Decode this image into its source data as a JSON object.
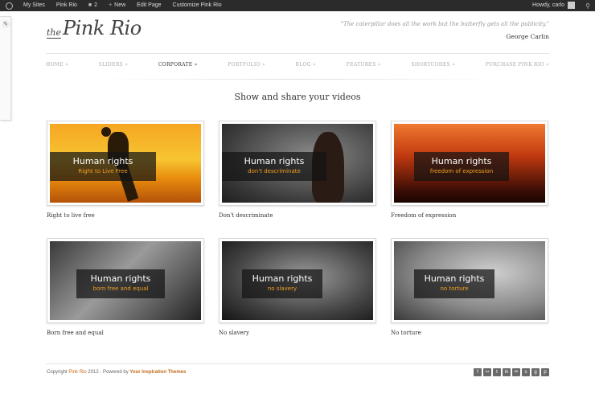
{
  "adminbar": {
    "my_sites": "My Sites",
    "site_name": "Pink Rio",
    "comments_count": "2",
    "new_label": "New",
    "edit_page": "Edit Page",
    "customize": "Customize Pink Rio",
    "howdy": "Howdy, carlo"
  },
  "header": {
    "logo_the": "the",
    "logo_name": "Pink Rio",
    "quote_text": "\"The caterpillar does all the work but the butterfly gets all the publicity.\"",
    "quote_author": "George Carlin"
  },
  "nav": {
    "items": [
      {
        "label": "HOME »"
      },
      {
        "label": "SLIDERS »"
      },
      {
        "label": "CORPORATE »"
      },
      {
        "label": "PORTFOLIO »"
      },
      {
        "label": "BLOG »"
      },
      {
        "label": "FEATURES »"
      },
      {
        "label": "SHORTCODES »"
      },
      {
        "label": "PURCHASE PINK RIO »"
      }
    ],
    "active_index": 2
  },
  "section_title": "Show and share your videos",
  "videos": [
    {
      "heading": "Human rights",
      "subtitle": "Right to Live Free",
      "label": "Right to live free"
    },
    {
      "heading": "Human rights",
      "subtitle": "don't descriminate",
      "label": "Don't descriminate"
    },
    {
      "heading": "Human rights",
      "subtitle": "freedom of expression",
      "label": "Freedom of expression"
    },
    {
      "heading": "Human rights",
      "subtitle": "born free and equal",
      "label": "Born free and equal"
    },
    {
      "heading": "Human rights",
      "subtitle": "no slavery",
      "label": "No slavery"
    },
    {
      "heading": "Human rights",
      "subtitle": "no torture",
      "label": "No torture"
    }
  ],
  "footer": {
    "copyright_prefix": "Copyright",
    "site_link": "Pink Rio",
    "year_powered": "2012 - Powered by",
    "theme_link": "Your Inspiration Themes"
  },
  "social_icons": [
    "f",
    "rss",
    "t",
    "in",
    "flickr",
    "sk",
    "g",
    "p"
  ],
  "colors": {
    "accent": "#c06a1a",
    "caption_sub": "#f0a020",
    "adminbar_bg": "#2b2b2b"
  }
}
